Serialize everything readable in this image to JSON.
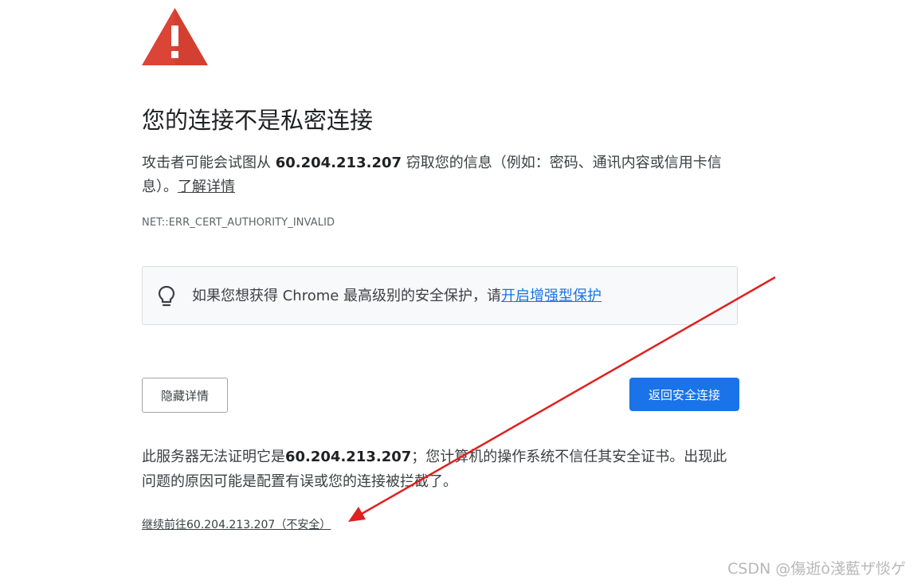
{
  "page": {
    "title": "您的连接不是私密连接",
    "description": {
      "prefix": "攻击者可能会试图从 ",
      "host": "60.204.213.207",
      "suffix": " 窃取您的信息（例如：密码、通讯内容或信用卡信息）。",
      "learn_more": "了解详情"
    },
    "error_code": "NET::ERR_CERT_AUTHORITY_INVALID",
    "enhanced_protection": {
      "text": "如果您想获得 Chrome 最高级别的安全保护，请",
      "link": "开启增强型保护"
    },
    "buttons": {
      "hide_details": "隐藏详情",
      "back_to_safety": "返回安全连接"
    },
    "details": {
      "prefix": "此服务器无法证明它是",
      "host": "60.204.213.207",
      "suffix": "；您计算机的操作系统不信任其安全证书。出现此问题的原因可能是配置有误或您的连接被拦截了。"
    },
    "proceed_link": "继续前往60.204.213.207（不安全）"
  },
  "watermark": "CSDN @傷逝ò淺藍ザ惔ゲ",
  "colors": {
    "warning_red": "#db4437",
    "primary_blue": "#1a73e8",
    "annotation_arrow": "#e02020"
  },
  "icons": {
    "warning": "warning-triangle-icon",
    "bulb": "lightbulb-icon"
  }
}
